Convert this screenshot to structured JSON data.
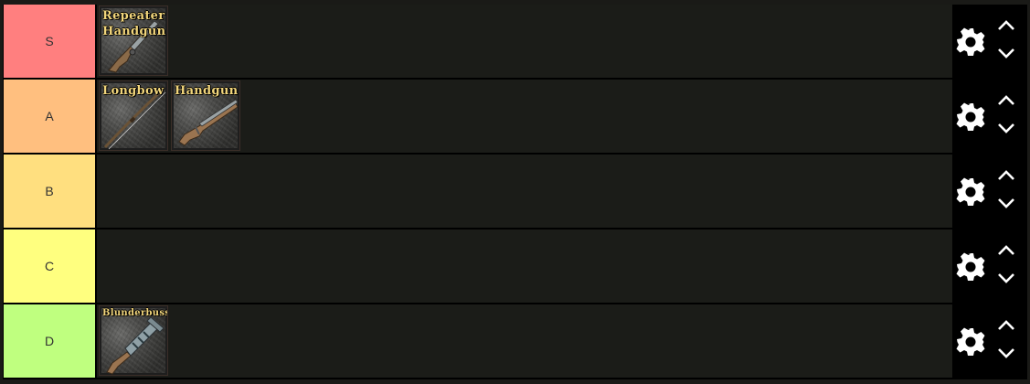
{
  "tiers": [
    {
      "label": "S",
      "color": "#ff7f7f",
      "items": [
        {
          "name": "Repeater Handgun",
          "icon": "repeater-handgun-icon"
        }
      ]
    },
    {
      "label": "A",
      "color": "#ffbf7f",
      "items": [
        {
          "name": "Longbow",
          "icon": "longbow-icon"
        },
        {
          "name": "Handgun",
          "icon": "handgun-icon"
        }
      ]
    },
    {
      "label": "B",
      "color": "#ffdf7f",
      "items": []
    },
    {
      "label": "C",
      "color": "#ffff7f",
      "items": []
    },
    {
      "label": "D",
      "color": "#bfff7f",
      "items": [
        {
          "name": "Blunderbuss",
          "icon": "blunderbuss-icon"
        }
      ]
    }
  ],
  "controls": {
    "settings_icon": "gear-icon",
    "move_up_icon": "chevron-up-icon",
    "move_down_icon": "chevron-down-icon"
  }
}
